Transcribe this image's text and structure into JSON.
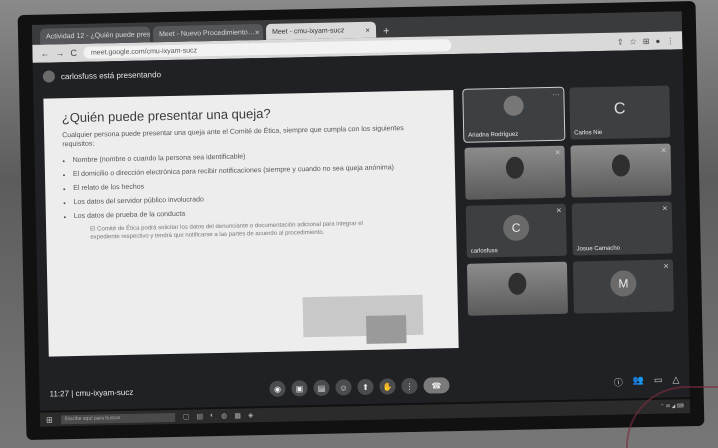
{
  "browser": {
    "tabs": [
      {
        "label": "Actividad 12 - ¿Quién puede presentar…",
        "active": false
      },
      {
        "label": "Meet - Nuevo Procedimiento…",
        "active": false
      },
      {
        "label": "Meet - cmu-ixyam-sucz",
        "active": true
      }
    ],
    "url": "meet.google.com/cmu-ixyam-sucz",
    "new_tab": "+",
    "nav": {
      "back": "←",
      "forward": "→",
      "reload": "C"
    }
  },
  "meet": {
    "presenting_text": "carlosfuss está presentando",
    "time": "11:27",
    "meeting_code": "cmu-ixyam-sucz"
  },
  "slide": {
    "title": "¿Quién puede presentar una queja?",
    "intro": "Cualquier persona puede presentar una queja ante el Comité de Ética, siempre que cumpla con los siguientes requisitos:",
    "bullets": [
      "Nombre (nombre o cuando la persona sea identificable)",
      "El domicilio o dirección electrónica para recibir notificaciones (siempre y cuando no sea queja anónima)",
      "El relato de los hechos",
      "Los datos del servidor público involucrado",
      "Los datos de prueba de la conducta"
    ],
    "note": "El Comité de Ética podrá solicitar los datos del denunciante o documentación adicional para integrar el expediente respectivo y tendrá que notificarse a las partes de acuerdo al procedimiento."
  },
  "participants": [
    {
      "name": "Ariadna Rodríguez",
      "type": "logo",
      "highlight": true
    },
    {
      "name": "Carlos Nie",
      "type": "initial",
      "initial": "C"
    },
    {
      "name": "",
      "type": "video"
    },
    {
      "name": "",
      "type": "video"
    },
    {
      "name": "carlosfuss",
      "type": "circle",
      "initial": "C"
    },
    {
      "name": "Josue Camacho",
      "type": "initial",
      "initial": ""
    },
    {
      "name": "",
      "type": "video"
    },
    {
      "name": "",
      "type": "circle",
      "initial": "M"
    }
  ],
  "controls": {
    "buttons": [
      "mic-icon",
      "camera-icon",
      "captions-icon",
      "emoji-icon",
      "present-icon",
      "hand-icon",
      "more-icon"
    ],
    "end_label": "☎",
    "right": [
      "info-icon",
      "people-icon",
      "chat-icon",
      "activities-icon"
    ]
  },
  "taskbar": {
    "search_placeholder": "Escribe aquí para buscar"
  },
  "colors": {
    "background": "#202124",
    "slide": "#ededed",
    "tile": "#3c4043"
  }
}
